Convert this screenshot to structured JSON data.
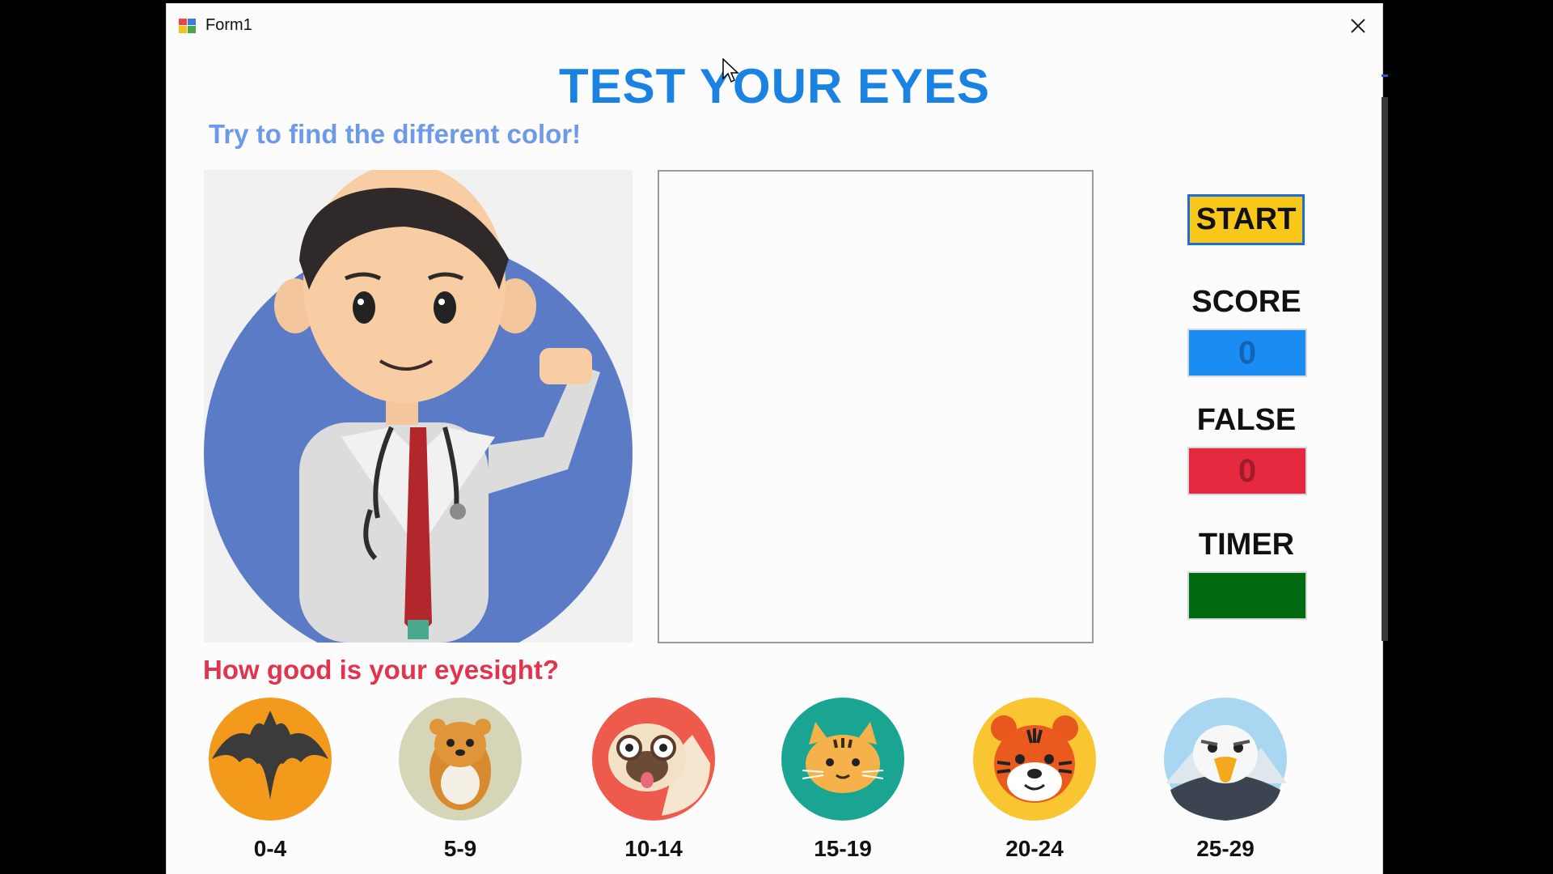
{
  "window": {
    "title": "Form1"
  },
  "header": {
    "title": "TEST YOUR EYES",
    "subtitle": "Try to find the different color!"
  },
  "controls": {
    "start_label": "START",
    "score_label": "SCORE",
    "score_value": "0",
    "false_label": "FALSE",
    "false_value": "0",
    "timer_label": "TIMER",
    "timer_value": ""
  },
  "colors": {
    "title": "#1a82e2",
    "subtitle": "#6d9ae8",
    "question": "#e0344f",
    "start_bg": "#f7c81a",
    "start_border": "#1a6fd8",
    "score_bg": "#1b8cf2",
    "false_bg": "#e5293f",
    "timer_bg": "#006a12"
  },
  "eyesight": {
    "question": "How good is your eyesight?",
    "levels": [
      {
        "range": "0-4",
        "icon": "bat-icon"
      },
      {
        "range": "5-9",
        "icon": "hamster-icon"
      },
      {
        "range": "10-14",
        "icon": "pug-icon"
      },
      {
        "range": "15-19",
        "icon": "cat-icon"
      },
      {
        "range": "20-24",
        "icon": "tiger-icon"
      },
      {
        "range": "25-29",
        "icon": "eagle-icon"
      }
    ]
  }
}
